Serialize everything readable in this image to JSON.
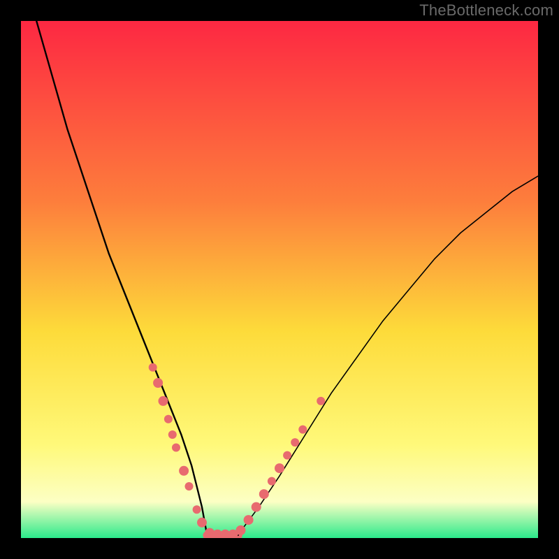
{
  "attribution": "TheBottleneck.com",
  "colors": {
    "frame": "#000000",
    "gradient_top": "#fd2842",
    "gradient_mid1": "#fd7e3c",
    "gradient_mid2": "#fddb3a",
    "gradient_mid3": "#fff97a",
    "gradient_mid4": "#fcffc4",
    "gradient_bottom": "#2bea8b",
    "curve": "#000000",
    "marker": "#e86a6f"
  },
  "chart_data": {
    "type": "line",
    "title": "",
    "xlabel": "",
    "ylabel": "",
    "xlim": [
      0,
      100
    ],
    "ylim": [
      0,
      100
    ],
    "series": [
      {
        "name": "bottleneck-curve",
        "x": [
          3,
          5,
          7,
          9,
          11,
          13,
          15,
          17,
          19,
          21,
          23,
          25,
          27,
          29,
          31,
          33,
          34,
          35,
          37,
          39,
          41,
          43,
          46,
          50,
          55,
          60,
          65,
          70,
          75,
          80,
          85,
          90,
          95,
          100
        ],
        "y": [
          100,
          93,
          86,
          79,
          73,
          67,
          61,
          55,
          50,
          45,
          40,
          35,
          30,
          25,
          20,
          14,
          10,
          6,
          2,
          0.5,
          0.5,
          2,
          6,
          12,
          20,
          28,
          35,
          42,
          48,
          54,
          59,
          63,
          67,
          70
        ]
      }
    ],
    "flat_bottom": {
      "x_from": 36,
      "x_to": 42,
      "y": 0.5
    },
    "markers": [
      {
        "x": 25.5,
        "y": 33,
        "r": 6
      },
      {
        "x": 26.5,
        "y": 30,
        "r": 7
      },
      {
        "x": 27.5,
        "y": 26.5,
        "r": 7
      },
      {
        "x": 28.5,
        "y": 23,
        "r": 6
      },
      {
        "x": 29.3,
        "y": 20,
        "r": 6
      },
      {
        "x": 30.0,
        "y": 17.5,
        "r": 6
      },
      {
        "x": 31.5,
        "y": 13,
        "r": 7
      },
      {
        "x": 32.5,
        "y": 10,
        "r": 6
      },
      {
        "x": 34.0,
        "y": 5.5,
        "r": 6
      },
      {
        "x": 35.0,
        "y": 3.0,
        "r": 7
      },
      {
        "x": 36.5,
        "y": 1.0,
        "r": 7
      },
      {
        "x": 38.0,
        "y": 0.7,
        "r": 7
      },
      {
        "x": 39.5,
        "y": 0.7,
        "r": 7
      },
      {
        "x": 41.0,
        "y": 0.7,
        "r": 7
      },
      {
        "x": 42.5,
        "y": 1.5,
        "r": 7
      },
      {
        "x": 44.0,
        "y": 3.5,
        "r": 7
      },
      {
        "x": 45.5,
        "y": 6.0,
        "r": 7
      },
      {
        "x": 47.0,
        "y": 8.5,
        "r": 7
      },
      {
        "x": 48.5,
        "y": 11,
        "r": 6
      },
      {
        "x": 50.0,
        "y": 13.5,
        "r": 7
      },
      {
        "x": 51.5,
        "y": 16,
        "r": 6
      },
      {
        "x": 53.0,
        "y": 18.5,
        "r": 6
      },
      {
        "x": 54.5,
        "y": 21,
        "r": 6
      },
      {
        "x": 58.0,
        "y": 26.5,
        "r": 6
      }
    ]
  }
}
